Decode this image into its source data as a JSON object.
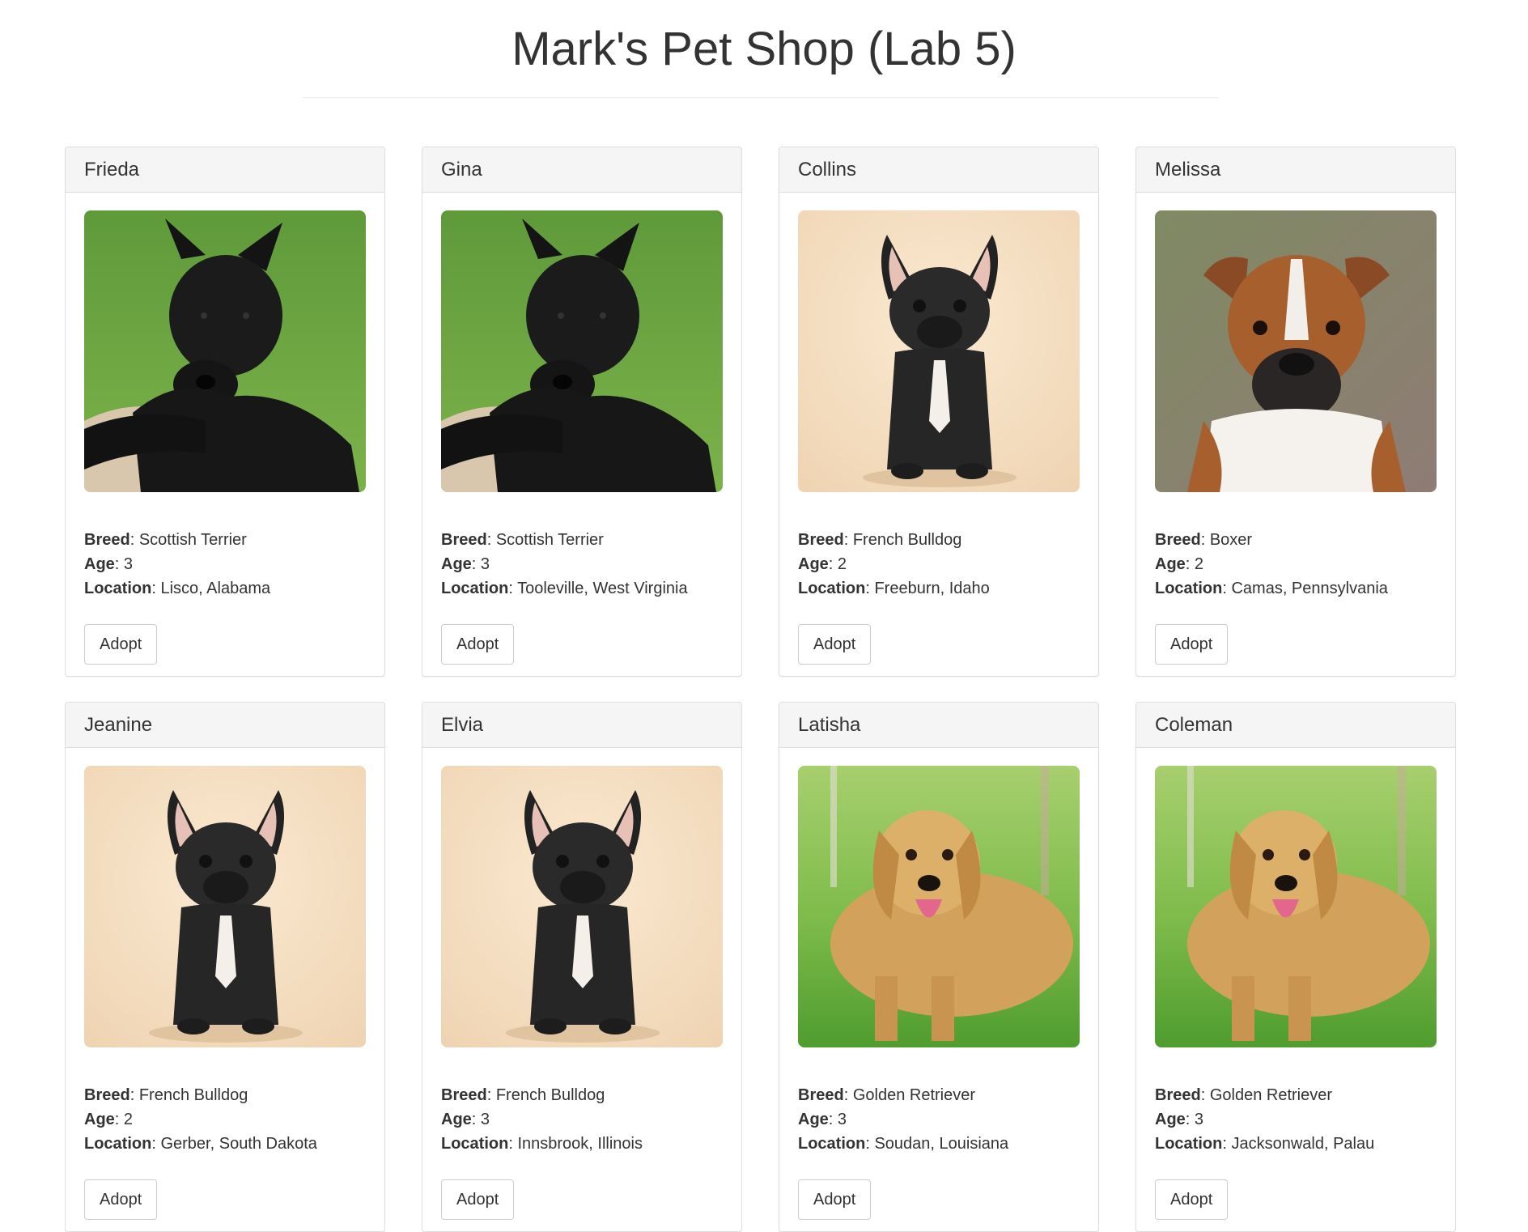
{
  "page": {
    "title": "Mark's Pet Shop (Lab 5)"
  },
  "labels": {
    "breed": "Breed",
    "age": "Age",
    "location": "Location",
    "adopt": "Adopt"
  },
  "pets": [
    {
      "name": "Frieda",
      "breed": "Scottish Terrier",
      "age": "3",
      "location": "Lisco, Alabama",
      "photo": "scottish-terrier"
    },
    {
      "name": "Gina",
      "breed": "Scottish Terrier",
      "age": "3",
      "location": "Tooleville, West Virginia",
      "photo": "scottish-terrier"
    },
    {
      "name": "Collins",
      "breed": "French Bulldog",
      "age": "2",
      "location": "Freeburn, Idaho",
      "photo": "french-bulldog"
    },
    {
      "name": "Melissa",
      "breed": "Boxer",
      "age": "2",
      "location": "Camas, Pennsylvania",
      "photo": "boxer"
    },
    {
      "name": "Jeanine",
      "breed": "French Bulldog",
      "age": "2",
      "location": "Gerber, South Dakota",
      "photo": "french-bulldog"
    },
    {
      "name": "Elvia",
      "breed": "French Bulldog",
      "age": "3",
      "location": "Innsbrook, Illinois",
      "photo": "french-bulldog"
    },
    {
      "name": "Latisha",
      "breed": "Golden Retriever",
      "age": "3",
      "location": "Soudan, Louisiana",
      "photo": "golden-retriever"
    },
    {
      "name": "Coleman",
      "breed": "Golden Retriever",
      "age": "3",
      "location": "Jacksonwald, Palau",
      "photo": "golden-retriever"
    }
  ]
}
